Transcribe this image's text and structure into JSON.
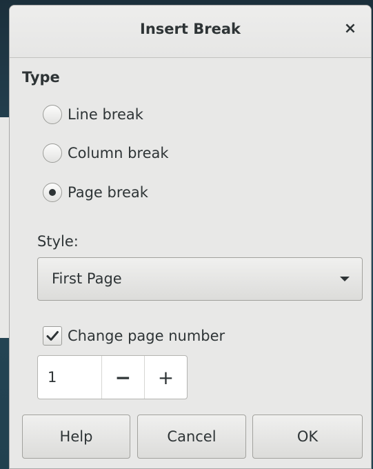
{
  "dialog": {
    "title": "Insert Break",
    "close_symbol": "×"
  },
  "type_section": {
    "title": "Type",
    "options": [
      {
        "label": "Line break",
        "selected": false
      },
      {
        "label": "Column break",
        "selected": false
      },
      {
        "label": "Page break",
        "selected": true
      }
    ]
  },
  "style": {
    "label": "Style:",
    "selected_value": "First Page"
  },
  "page_number": {
    "checkbox_label": "Change page number",
    "checked": true,
    "value": "1",
    "minus_symbol": "−",
    "plus_symbol": "+"
  },
  "buttons": {
    "help": "Help",
    "cancel": "Cancel",
    "ok": "OK"
  },
  "icons": {
    "close": "close-icon",
    "dropdown": "chevron-down-icon",
    "check": "checkmark-icon"
  }
}
